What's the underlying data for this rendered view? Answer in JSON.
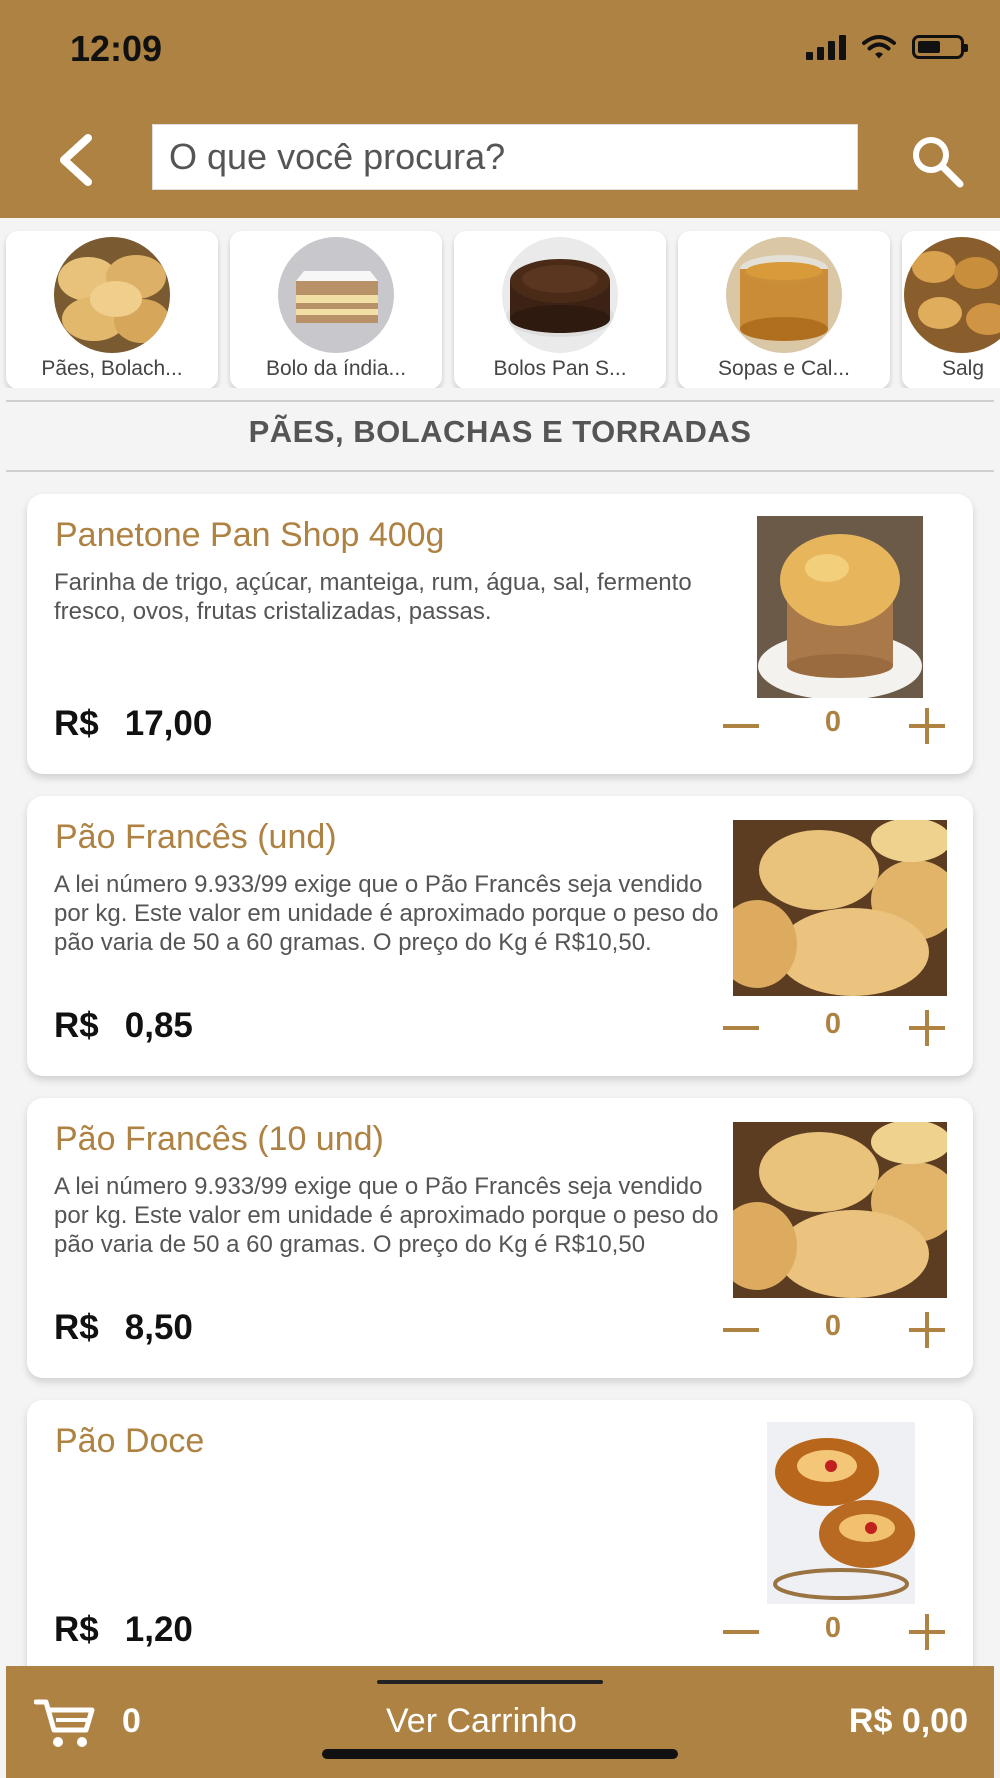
{
  "status_bar": {
    "time": "12:09"
  },
  "header": {
    "search_placeholder": "O que você procura?"
  },
  "categories": [
    {
      "label": "Pães, Bolach..."
    },
    {
      "label": "Bolo da índia..."
    },
    {
      "label": "Bolos Pan S..."
    },
    {
      "label": "Sopas e Cal..."
    },
    {
      "label": "Salg"
    }
  ],
  "section": {
    "title": "PÃES, BOLACHAS E TORRADAS"
  },
  "products": [
    {
      "name": "Panetone Pan Shop 400g",
      "description": "Farinha de trigo, açúcar, manteiga, rum, água, sal, fermento fresco, ovos, frutas cristalizadas, passas.",
      "currency": "R$",
      "price": "17,00",
      "qty": "0"
    },
    {
      "name": "Pão Francês (und)",
      "description": "A lei número 9.933/99 exige que o Pão Francês seja vendido por kg. Este valor em unidade é aproximado porque o peso do pão varia de 50 a 60 gramas. O preço do Kg é R$10,50.",
      "currency": "R$",
      "price": "0,85",
      "qty": "0"
    },
    {
      "name": "Pão Francês (10 und)",
      "description": "A lei número 9.933/99 exige que o Pão Francês seja vendido por kg. Este valor em unidade é aproximado porque o peso do pão varia de 50 a 60 gramas. O preço do Kg é R$10,50",
      "currency": "R$",
      "price": "8,50",
      "qty": "0"
    },
    {
      "name": "Pão Doce",
      "description": "",
      "currency": "R$",
      "price": "1,20",
      "qty": "0"
    }
  ],
  "cart": {
    "count": "0",
    "link_label": "Ver Carrinho",
    "total": "R$ 0,00"
  },
  "colors": {
    "brand": "#ad8242",
    "background": "#f4f4f4"
  }
}
